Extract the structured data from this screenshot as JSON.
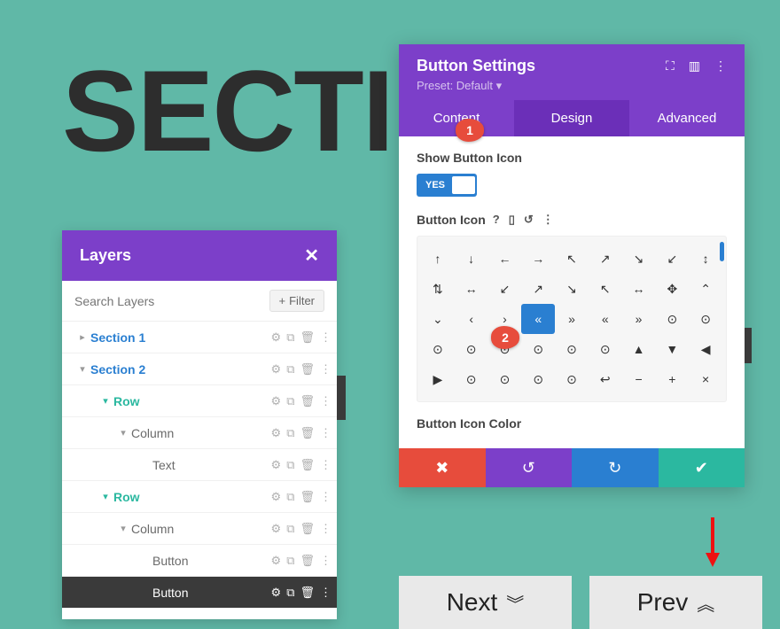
{
  "big_text": "SECTI",
  "layers_panel": {
    "title": "Layers",
    "search_placeholder": "Search Layers",
    "filter_label": "Filter",
    "items": [
      {
        "label": "Section 1",
        "kind": "section",
        "color": "blue",
        "chev": "▸",
        "depth": 1
      },
      {
        "label": "Section 2",
        "kind": "section",
        "color": "blue",
        "chev": "▾",
        "depth": 1
      },
      {
        "label": "Row",
        "kind": "row",
        "color": "teal",
        "chev": "▾",
        "depth": 2
      },
      {
        "label": "Column",
        "kind": "column",
        "color": "grey",
        "chev": "▾",
        "depth": 3
      },
      {
        "label": "Text",
        "kind": "module",
        "color": "grey",
        "chev": "",
        "depth": 4
      },
      {
        "label": "Row",
        "kind": "row",
        "color": "teal",
        "chev": "▾",
        "depth": 2
      },
      {
        "label": "Column",
        "kind": "column",
        "color": "grey",
        "chev": "▾",
        "depth": 3
      },
      {
        "label": "Button",
        "kind": "module",
        "color": "grey",
        "chev": "",
        "depth": 4
      },
      {
        "label": "Button",
        "kind": "module",
        "color": "dark",
        "chev": "",
        "depth": 4
      }
    ]
  },
  "settings_panel": {
    "title": "Button Settings",
    "preset": "Preset: Default ▾",
    "tabs": {
      "content": "Content",
      "design": "Design",
      "advanced": "Advanced",
      "active": "design"
    },
    "show_icon_label": "Show Button Icon",
    "toggle_value": "YES",
    "button_icon_label": "Button Icon",
    "button_icon_color_label": "Button Icon Color",
    "icons": [
      "↑",
      "↓",
      "←",
      "→",
      "↖",
      "↗",
      "↘",
      "↙",
      "↕",
      "⇅",
      "↔",
      "↙",
      "↗",
      "↘",
      "↖",
      "↔",
      "✥",
      "⌃",
      "⌄",
      "‹",
      "›",
      "«",
      "»",
      "«",
      "»",
      "⊙",
      "⊙",
      "⊙",
      "⊙",
      "⊙",
      "⊙",
      "⊙",
      "⊙",
      "▲",
      "▼",
      "◀",
      "▶",
      "⊙",
      "⊙",
      "⊙",
      "⊙",
      "↩",
      "−",
      "+",
      "×"
    ],
    "selected_icon_index": 21
  },
  "badges": {
    "one": "1",
    "two": "2"
  },
  "pagination": {
    "next": "Next",
    "prev": "Prev"
  }
}
